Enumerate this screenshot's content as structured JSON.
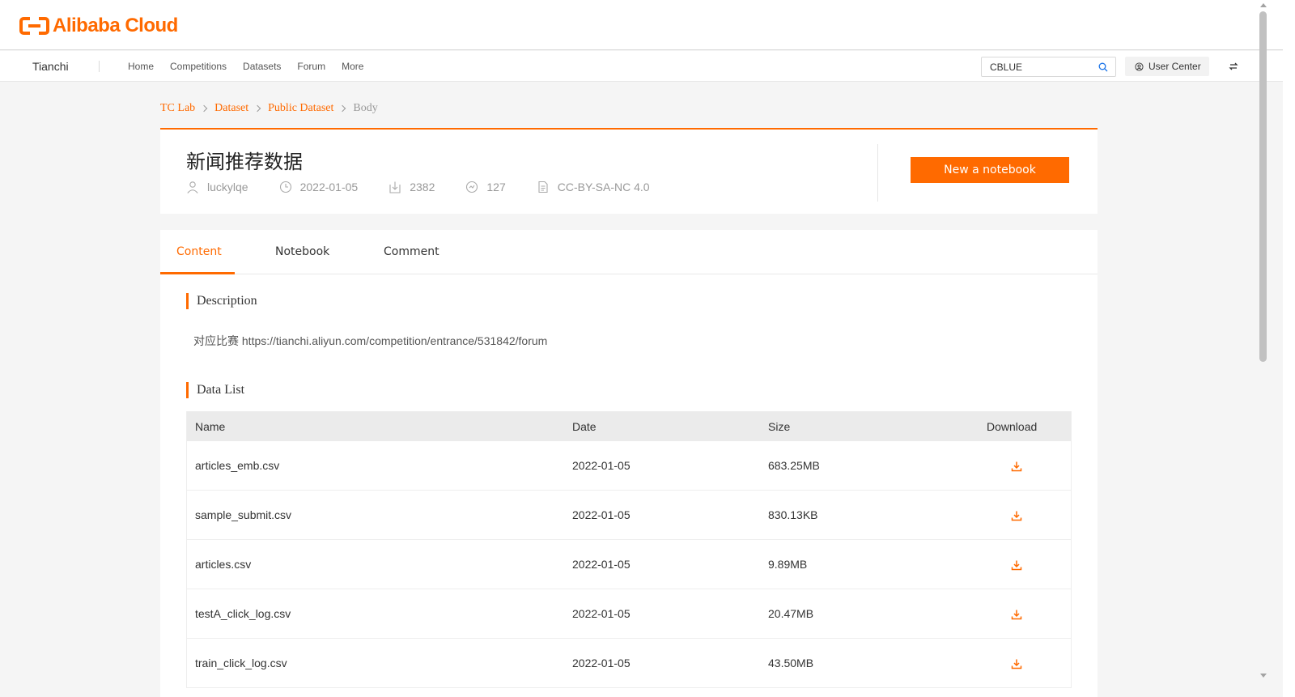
{
  "brand": {
    "logo_text": "Alibaba Cloud"
  },
  "nav": {
    "brand": "Tianchi",
    "links": [
      "Home",
      "Competitions",
      "Datasets",
      "Forum",
      "More"
    ],
    "search_value": "CBLUE",
    "user_center": "User Center"
  },
  "breadcrumb": [
    "TC Lab",
    "Dataset",
    "Public Dataset",
    "Body"
  ],
  "dataset": {
    "title": "新闻推荐数据",
    "author": "luckylqe",
    "date": "2022-01-05",
    "downloads": "2382",
    "likes": "127",
    "license": "CC-BY-SA-NC 4.0",
    "notebook_button": "New a notebook"
  },
  "tabs": [
    "Content",
    "Notebook",
    "Comment"
  ],
  "description": {
    "title": "Description",
    "text": "对应比赛 https://tianchi.aliyun.com/competition/entrance/531842/forum"
  },
  "data_list": {
    "title": "Data List",
    "columns": [
      "Name",
      "Date",
      "Size",
      "Download"
    ],
    "rows": [
      {
        "name": "articles_emb.csv",
        "date": "2022-01-05",
        "size": "683.25MB"
      },
      {
        "name": "sample_submit.csv",
        "date": "2022-01-05",
        "size": "830.13KB"
      },
      {
        "name": "articles.csv",
        "date": "2022-01-05",
        "size": "9.89MB"
      },
      {
        "name": "testA_click_log.csv",
        "date": "2022-01-05",
        "size": "20.47MB"
      },
      {
        "name": "train_click_log.csv",
        "date": "2022-01-05",
        "size": "43.50MB"
      }
    ]
  },
  "colors": {
    "accent": "#ff6a00",
    "page_bg": "#f5f5f5",
    "header_row": "#ebebeb"
  },
  "icons": [
    "search-icon",
    "user-circle-icon",
    "switch-icon",
    "user-icon",
    "clock-icon",
    "download-count-icon",
    "like-icon",
    "license-icon",
    "download-icon"
  ]
}
